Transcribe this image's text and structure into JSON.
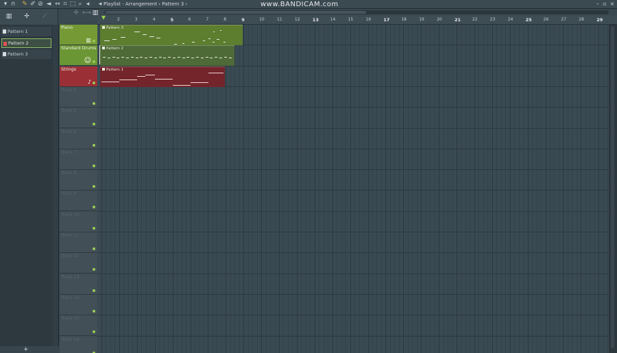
{
  "window": {
    "title": "Playlist - Arrangement › Pattern 3 ›",
    "watermark": "www.BANDICAM.com"
  },
  "toolbar": {
    "icons": [
      "magnet-icon",
      "pencil-icon",
      "brush-icon",
      "delete-icon",
      "mute-icon",
      "slip-icon",
      "select-icon",
      "zoom-icon",
      "playback-icon"
    ]
  },
  "picker": {
    "items": [
      {
        "label": "Pattern 1",
        "selected": false
      },
      {
        "label": "Pattern 2",
        "selected": true
      },
      {
        "label": "Pattern 3",
        "selected": false
      }
    ],
    "add_label": "+"
  },
  "ruler": {
    "bars": [
      "2",
      "3",
      "4",
      "5",
      "6",
      "7",
      "8",
      "9",
      "10",
      "11",
      "12",
      "13",
      "14",
      "15",
      "16",
      "17",
      "18",
      "19",
      "20",
      "21",
      "22",
      "23",
      "24",
      "25",
      "26",
      "27",
      "28",
      "29"
    ]
  },
  "tracks": [
    {
      "name": "Piano"
    },
    {
      "name": "Standard Drums"
    },
    {
      "name": "Strings"
    },
    {
      "name": "Track 4"
    },
    {
      "name": "Track 5"
    },
    {
      "name": "Track 6"
    },
    {
      "name": "Track 7"
    },
    {
      "name": "Track 8"
    },
    {
      "name": "Track 9"
    },
    {
      "name": "Track 10"
    },
    {
      "name": "Track 11"
    },
    {
      "name": "Track 12"
    },
    {
      "name": "Track 13"
    },
    {
      "name": "Track 14"
    },
    {
      "name": "Track 15"
    },
    {
      "name": "Track 16"
    }
  ],
  "clips": [
    {
      "label": "Pattern 3",
      "track": "Piano"
    },
    {
      "label": "Pattern 2",
      "track": "Standard Drums"
    },
    {
      "label": "Pattern 1",
      "track": "Strings"
    }
  ]
}
